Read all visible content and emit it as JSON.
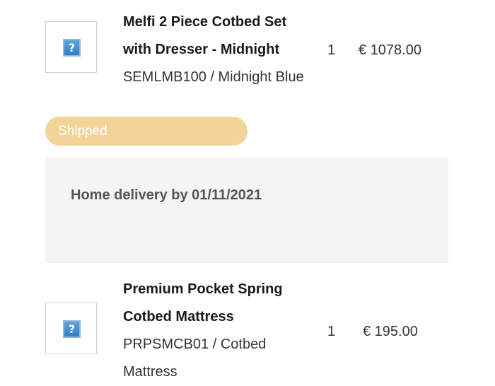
{
  "items": [
    {
      "title_line1": "Melfi 2 Piece Cotbed Set",
      "title_line2": "with Dresser - Midnight",
      "sku": "SEMLMB100 / Midnight Blue",
      "qty": "1",
      "price": "€ 1078.00",
      "image_icon": "missing-image-icon"
    },
    {
      "title_line1": "Premium Pocket Spring",
      "title_line2": "Cotbed Mattress",
      "sku_line1": "PRPSMCB01 / Cotbed",
      "sku_line2": "Mattress",
      "qty": "1",
      "price": "€ 195.00",
      "image_icon": "missing-image-icon"
    }
  ],
  "status": {
    "label": "Shipped",
    "color": "#f2d398"
  },
  "delivery": {
    "text": "Home delivery by 01/11/2021"
  },
  "placeholder_glyph": "?"
}
